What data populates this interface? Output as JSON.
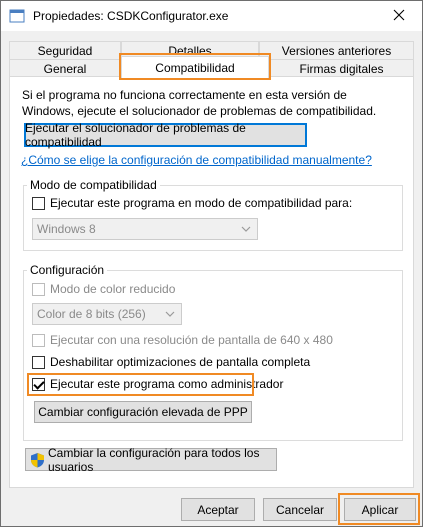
{
  "window": {
    "title": "Propiedades: CSDKConfigurator.exe"
  },
  "tabs": {
    "row1": [
      "Seguridad",
      "Detalles",
      "Versiones anteriores"
    ],
    "row2": [
      "General",
      "Compatibilidad",
      "Firmas digitales"
    ],
    "active": "Compatibilidad"
  },
  "intro": {
    "line1": "Si el programa no funciona correctamente en esta versión de",
    "line2": "Windows, ejecute el solucionador de problemas de compatibilidad."
  },
  "troubleshooter_button": "Ejecutar el solucionador de problemas de compatibilidad",
  "help_link": "¿Cómo se elige la configuración de compatibilidad manualmente?",
  "compat_mode": {
    "group_label": "Modo de compatibilidad",
    "checkbox_label": "Ejecutar este programa en modo de compatibilidad para:",
    "checked": false,
    "os_value": "Windows 8"
  },
  "settings": {
    "group_label": "Configuración",
    "reduced_color_label": "Modo de color reducido",
    "color_value": "Color de 8 bits (256)",
    "resolution_label": "Ejecutar con una resolución de pantalla de 640 x 480",
    "fullscreen_label": "Deshabilitar optimizaciones de pantalla completa",
    "admin_label": "Ejecutar este programa como administrador",
    "admin_checked": true,
    "dpi_button": "Cambiar configuración elevada de PPP"
  },
  "all_users_button": "Cambiar la configuración para todos los usuarios",
  "footer": {
    "ok": "Aceptar",
    "cancel": "Cancelar",
    "apply": "Aplicar"
  },
  "colors": {
    "highlight": "#f08a24",
    "link": "#0066cc",
    "focus": "#0078d7"
  }
}
